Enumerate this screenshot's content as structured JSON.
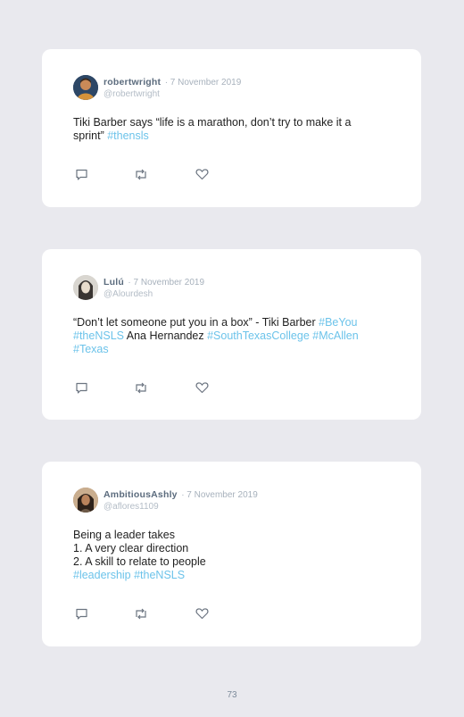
{
  "tweets": [
    {
      "name": "robertwright",
      "date": "· 7 November 2019",
      "handle": "@robertwright",
      "text_lines": [
        {
          "plain": "Tiki Barber says “life is a marathon, don’t try to make it a"
        },
        {
          "plain": "sprint” ",
          "tag": "#thensls"
        }
      ]
    },
    {
      "name": "Lulú",
      "date": "· 7 November 2019",
      "handle": "@Alourdesh",
      "text_lines": [
        {
          "plain": "“Don’t let someone put you in a box” - Tiki Barber ",
          "tag": "#BeYou"
        },
        {
          "tag": "#theNSLS",
          "plain": " Ana Hernandez ",
          "tag2": "#SouthTexasCollege #McAllen"
        },
        {
          "tag": "#Texas"
        }
      ]
    },
    {
      "name": "AmbitiousAshly",
      "date": "· 7 November 2019",
      "handle": "@aflores1109",
      "text_lines": [
        {
          "plain": "Being a leader takes"
        },
        {
          "plain": "1. A very clear direction"
        },
        {
          "plain": "2. A skill to relate to people"
        },
        {
          "tag": "#leadership #theNSLS"
        }
      ]
    }
  ],
  "icons": {
    "reply": "comment-icon",
    "retweet": "retweet-icon",
    "like": "heart-icon"
  },
  "colors": {
    "background": "#e9e9ee",
    "card": "#ffffff",
    "hashtag": "#6cc3ea",
    "name": "#5b6b7d"
  },
  "page_number": "73"
}
